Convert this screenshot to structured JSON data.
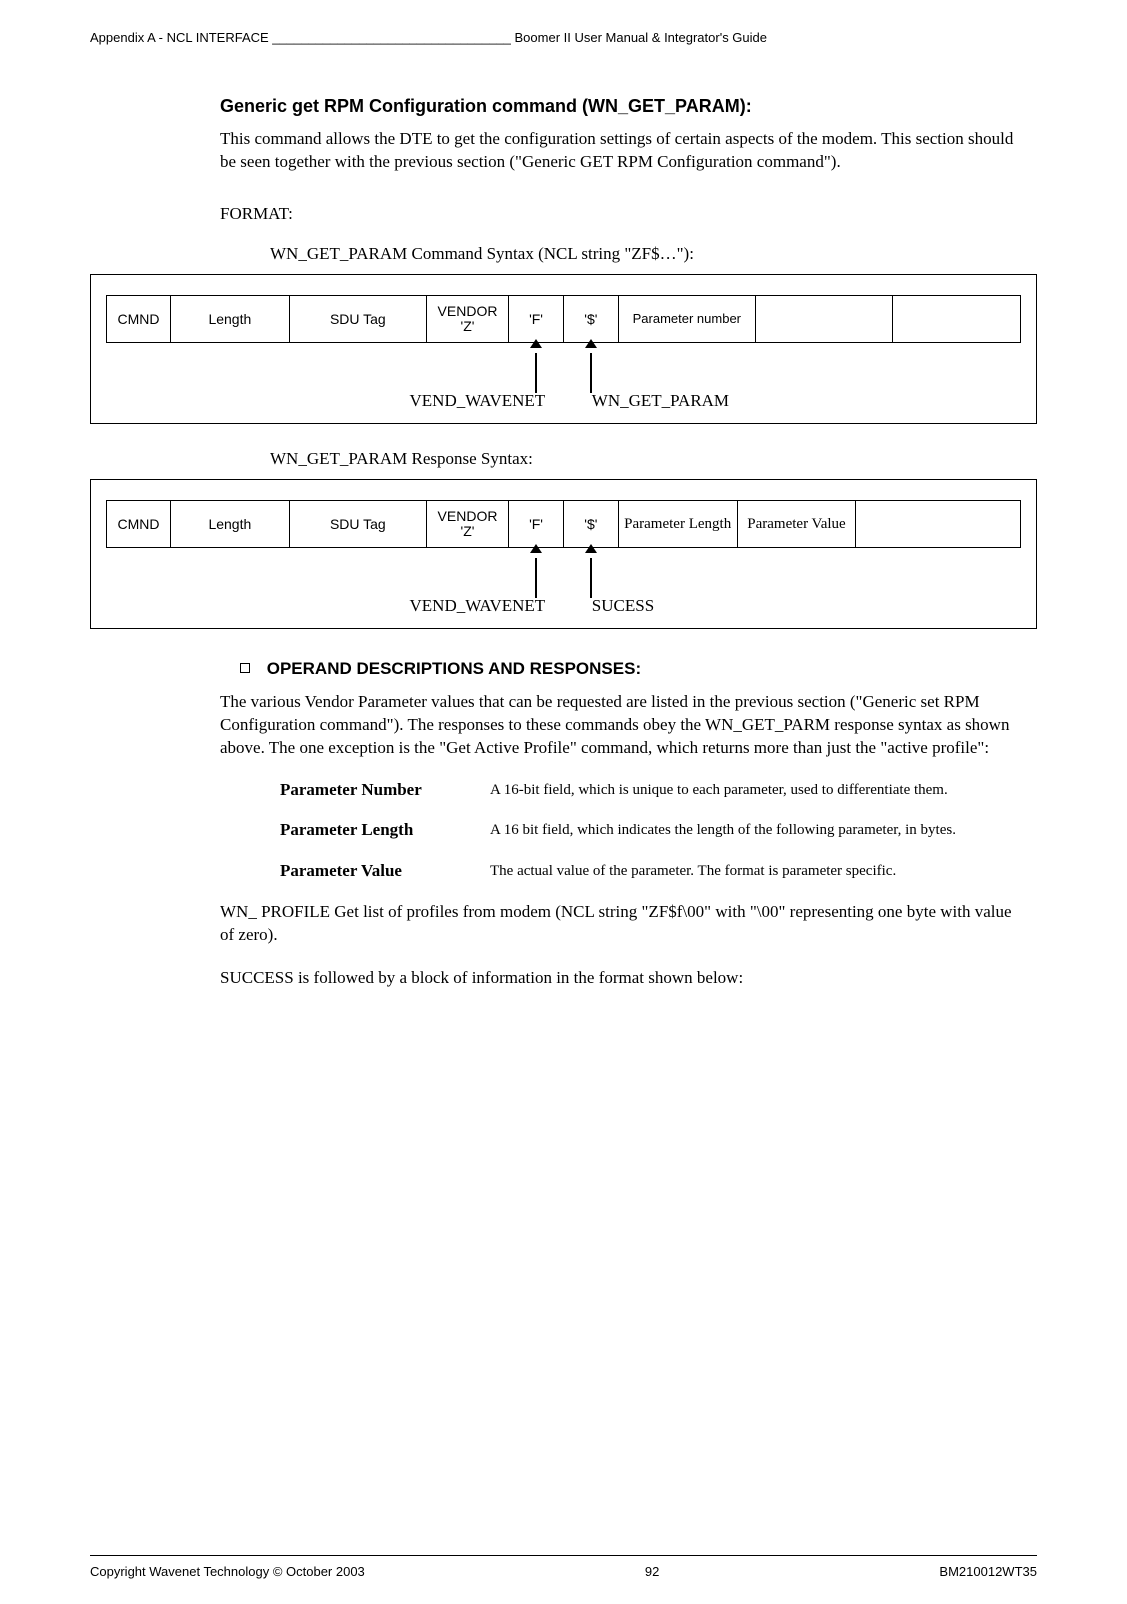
{
  "header": {
    "left": "Appendix A - NCL INTERFACE _________________________________ Boomer II User Manual & Integrator's Guide"
  },
  "section": {
    "title": "Generic get RPM Configuration command (WN_GET_PARAM):",
    "intro": "This command allows the DTE to get the configuration settings of certain aspects of the modem.  This section should be seen together with the previous section (\"Generic GET RPM Configuration command\").",
    "format_label": "FORMAT:"
  },
  "diagram1": {
    "caption": "WN_GET_PARAM Command Syntax (NCL string \"ZF$…\"):",
    "cells": [
      "CMND",
      "Length",
      "SDU Tag",
      "VENDOR 'Z'",
      "'F'",
      "'$'",
      "Parameter number",
      "",
      ""
    ],
    "callout_f": "VEND_WAVENET",
    "callout_s": "WN_GET_PARAM"
  },
  "diagram2": {
    "caption": "WN_GET_PARAM Response Syntax:",
    "cells": [
      "CMND",
      "Length",
      "SDU Tag",
      "VENDOR 'Z'",
      "'F'",
      "'$'",
      "Parameter Length",
      "Parameter Value",
      ""
    ],
    "callout_f": "VEND_WAVENET",
    "callout_s": "SUCESS"
  },
  "operands": {
    "heading": "OPERAND DESCRIPTIONS AND RESPONSES:",
    "para": "The various Vendor Parameter values that can be requested  are listed in the previous section (\"Generic set RPM Configuration command\").  The responses to these commands obey the WN_GET_PARM response syntax as  shown above. The one exception is the \"Get Active Profile\" command, which returns more than just the \"active profile\":",
    "defs": [
      {
        "term": "Parameter Number",
        "desc": "A 16-bit field, which is unique to each parameter, used to differentiate them."
      },
      {
        "term": "Parameter Length",
        "desc": "A 16 bit field, which indicates the length of the following parameter, in bytes."
      },
      {
        "term": "Parameter Value",
        "desc": "The actual value of the parameter.  The format is parameter specific."
      }
    ],
    "wn_profile": "WN_ PROFILE  Get  list of profiles from modem (NCL string \"ZF$f\\00\" with \"\\00\"  representing one byte with value of zero).",
    "success_para": "SUCCESS is followed by a block of information in the format shown below:"
  },
  "footer": {
    "left": "Copyright Wavenet Technology © October 2003",
    "center": "92",
    "right": "BM210012WT35"
  }
}
